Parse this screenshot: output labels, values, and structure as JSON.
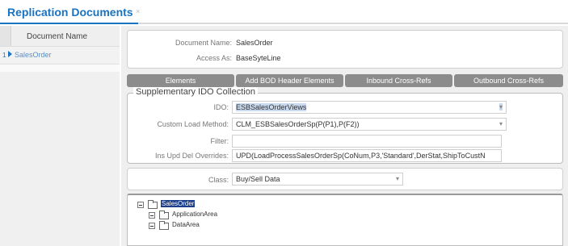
{
  "tabs": [
    {
      "label": "Replication Documents",
      "close": "×"
    }
  ],
  "grid": {
    "column_header": "Document Name",
    "rows": [
      {
        "num": "1",
        "name": "SalesOrder"
      }
    ]
  },
  "header": {
    "document_name_label": "Document Name:",
    "document_name_value": "SalesOrder",
    "access_as_label": "Access As:",
    "access_as_value": "BaseSyteLine"
  },
  "buttons": [
    "Elements",
    "Add BOD Header Elements",
    "Inbound Cross-Refs",
    "Outbound Cross-Refs"
  ],
  "supplementary": {
    "legend": "Supplementary IDO Collection",
    "ido_label": "IDO:",
    "ido_value": "ESBSalesOrderViews",
    "custom_load_label": "Custom Load Method:",
    "custom_load_value": "CLM_ESBSalesOrderSp(P(P1),P(F2))",
    "filter_label": "Filter:",
    "filter_value": "",
    "overrides_label": "Ins Upd Del Overrides:",
    "overrides_value": "UPD(LoadProcessSalesOrderSp(CoNum,P3,'Standard',DerStat,ShipToCustN"
  },
  "class_field": {
    "label": "Class:",
    "value": "Buy/Sell Data"
  },
  "tree": {
    "root": "SalesOrder",
    "children": [
      "ApplicationArea",
      "DataArea"
    ]
  },
  "icons": {
    "expand": "minus-box-icon",
    "folder": "folder-icon",
    "row_pointer": "arrow-right-icon",
    "dropdown": "chevron-down-icon"
  },
  "colors": {
    "accent": "#1a73c0",
    "button": "#8c8c8c",
    "selection": "#1c3f8c",
    "highlight": "#c9d9ee"
  }
}
